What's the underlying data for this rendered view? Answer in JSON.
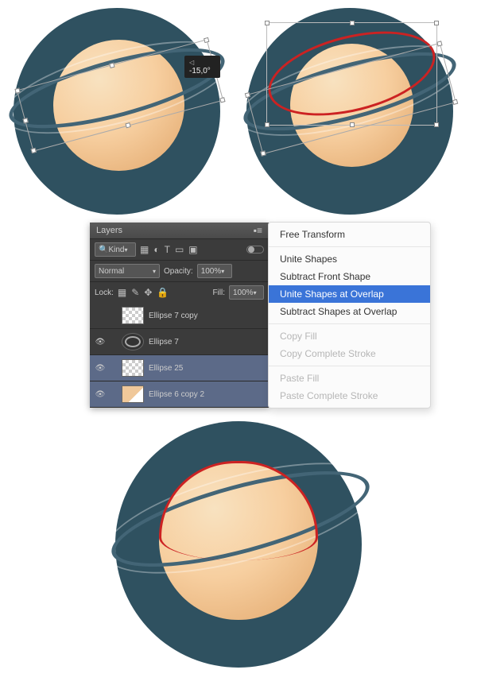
{
  "angle_tooltip": "-15,0°",
  "layers_panel": {
    "title": "Layers",
    "filter_label": "Kind",
    "blend_mode": "Normal",
    "opacity_label": "Opacity:",
    "opacity_value": "100%",
    "lock_label": "Lock:",
    "fill_label": "Fill:",
    "fill_value": "100%",
    "layers": [
      {
        "name": "Ellipse 7 copy",
        "visible": false,
        "selected": false,
        "thumb": "chk"
      },
      {
        "name": "Ellipse 7",
        "visible": true,
        "selected": false,
        "thumb": "ring"
      },
      {
        "name": "Ellipse 25",
        "visible": true,
        "selected": true,
        "thumb": "chk"
      },
      {
        "name": "Ellipse 6 copy 2",
        "visible": true,
        "selected": true,
        "thumb": "shape"
      }
    ]
  },
  "context_menu": {
    "items": [
      {
        "label": "Free Transform",
        "state": "normal"
      },
      {
        "sep": true
      },
      {
        "label": "Unite Shapes",
        "state": "normal"
      },
      {
        "label": "Subtract Front Shape",
        "state": "normal"
      },
      {
        "label": "Unite Shapes at Overlap",
        "state": "highlight"
      },
      {
        "label": "Subtract Shapes at Overlap",
        "state": "normal"
      },
      {
        "sep": true
      },
      {
        "label": "Copy Fill",
        "state": "dim"
      },
      {
        "label": "Copy Complete Stroke",
        "state": "dim"
      },
      {
        "sep": true
      },
      {
        "label": "Paste Fill",
        "state": "dim"
      },
      {
        "label": "Paste Complete Stroke",
        "state": "dim"
      }
    ]
  }
}
